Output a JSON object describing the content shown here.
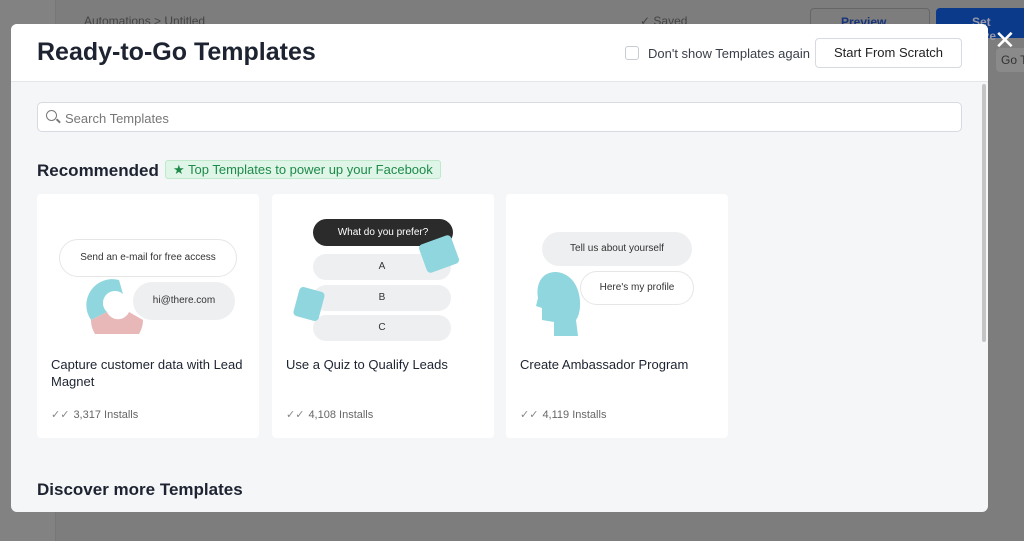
{
  "background": {
    "breadcrumb": "Automations > Untitled",
    "saved": "✓ Saved",
    "preview": "Preview",
    "set_live": "Set Live",
    "go": "Go T"
  },
  "modal": {
    "title": "Ready-to-Go Templates",
    "dont_show_label": "Don't show Templates again",
    "dont_show_checked": false,
    "start_scratch": "Start From Scratch",
    "close_icon": "close-icon",
    "search_placeholder": "Search Templates",
    "recommended": "Recommended",
    "badge": "★ Top Templates to power up your Facebook",
    "discover": "Discover more Templates",
    "cards": [
      {
        "title": "Capture customer data with Lead Magnet",
        "installs": "3,317 Installs",
        "preview": [
          "Send an e-mail for free access",
          "hi@there.com"
        ]
      },
      {
        "title": "Use a Quiz to Qualify Leads",
        "installs": "4,108 Installs",
        "preview": [
          "What do you prefer?",
          "A",
          "B",
          "C"
        ]
      },
      {
        "title": "Create Ambassador Program",
        "installs": "4,119 Installs",
        "preview": [
          "Tell us about yourself",
          "Here's my profile"
        ]
      }
    ]
  }
}
